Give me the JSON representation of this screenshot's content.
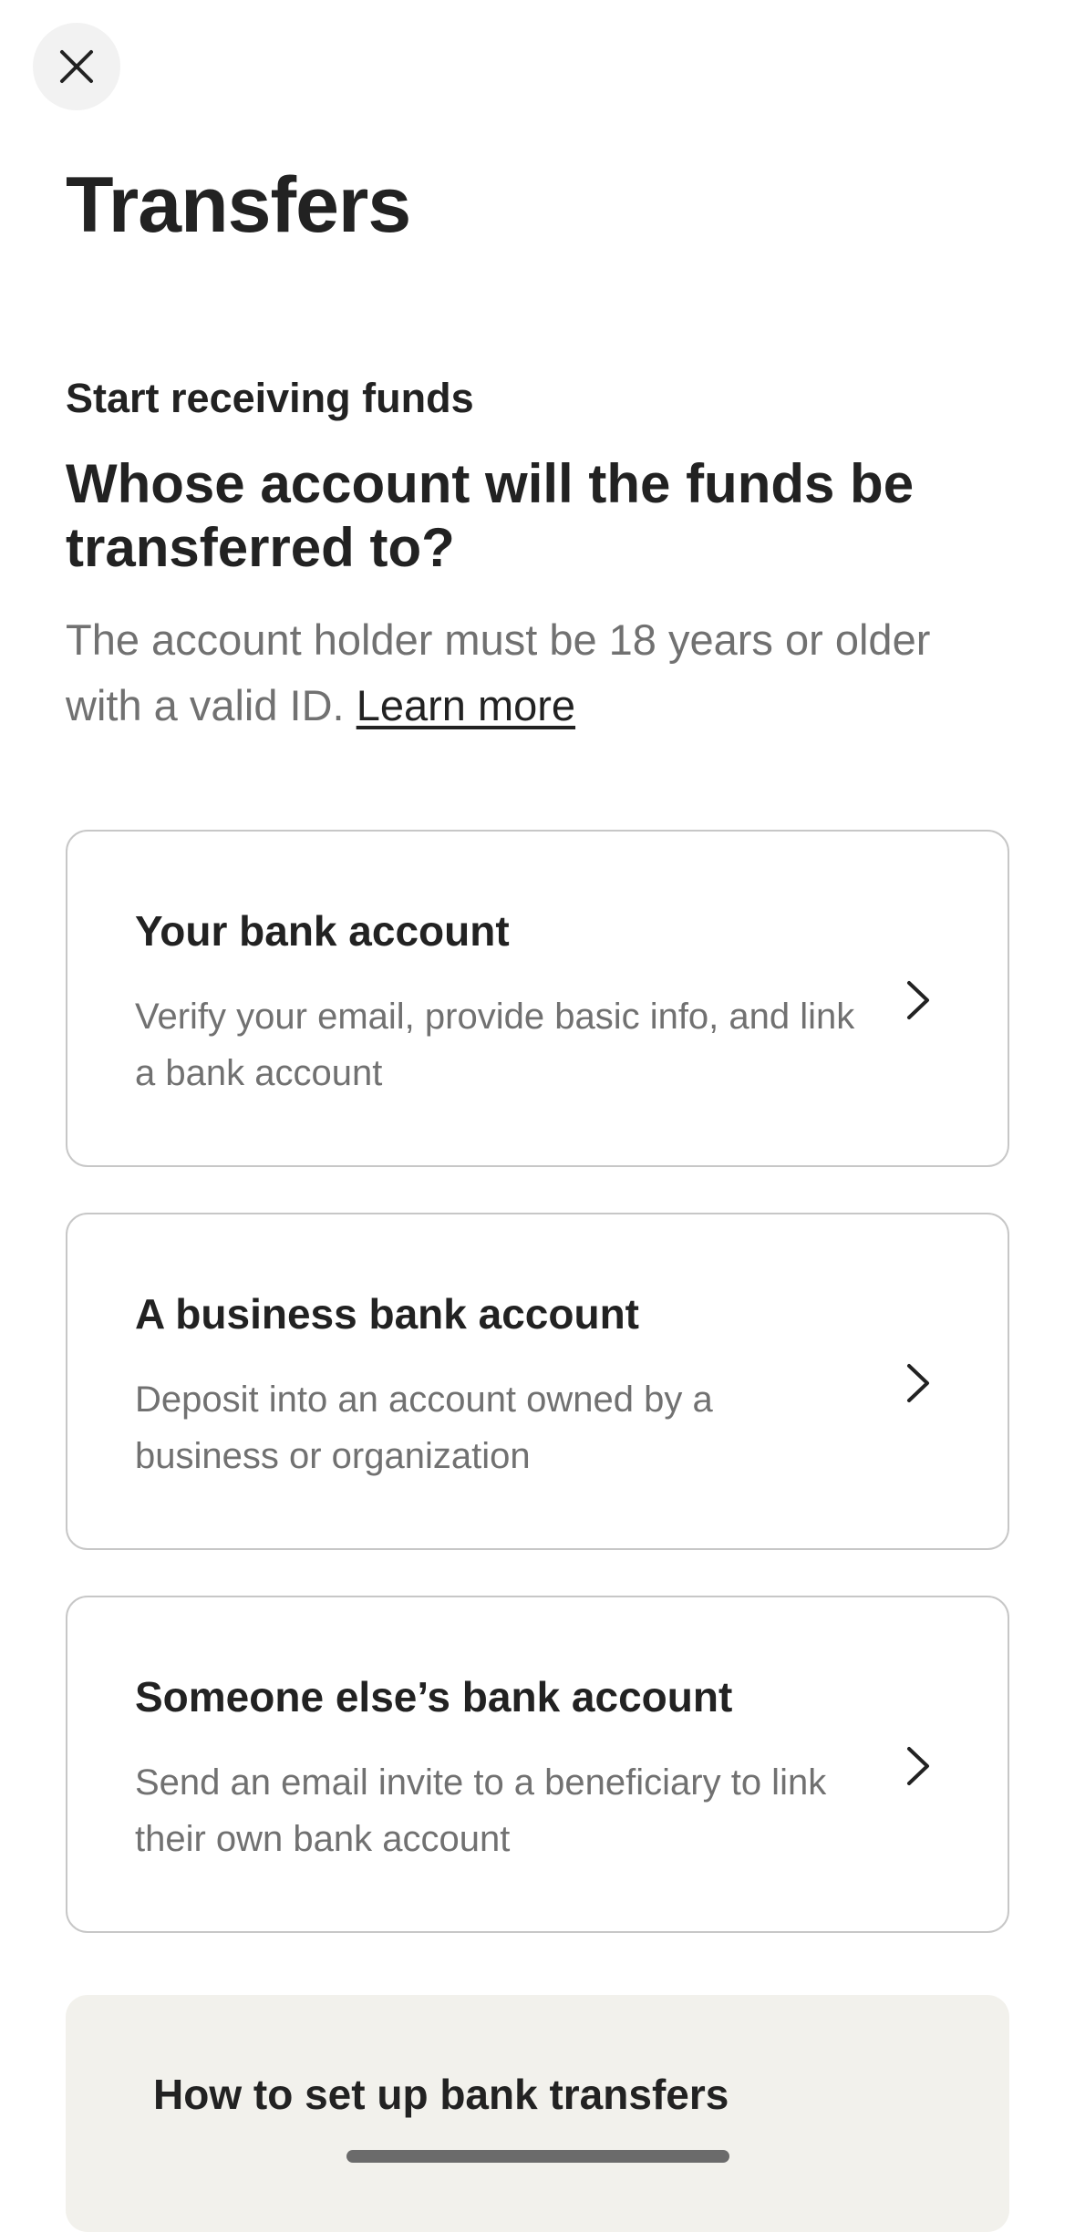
{
  "header": {
    "close_icon": "close-icon",
    "title": "Transfers"
  },
  "intro": {
    "eyebrow": "Start receiving funds",
    "question": "Whose account will the funds be transferred to?",
    "hint": "The account holder must be 18 years or older with a valid ID.",
    "learn_more": "Learn more"
  },
  "options": [
    {
      "title": "Your bank account",
      "description": "Verify your email, provide basic info, and link a bank account",
      "icon": "chevron-right-icon"
    },
    {
      "title": "A business bank account",
      "description": "Deposit into an account owned by a business or organization",
      "icon": "chevron-right-icon"
    },
    {
      "title": "Someone else’s bank account",
      "description": "Send an email invite to a beneficiary to link their own bank account",
      "icon": "chevron-right-icon"
    }
  ],
  "info": {
    "title": "How to set up bank transfers"
  },
  "colors": {
    "text_primary": "#222222",
    "text_secondary": "#717171",
    "card_border": "#c7c7c7",
    "info_background": "#f2f1ec"
  }
}
